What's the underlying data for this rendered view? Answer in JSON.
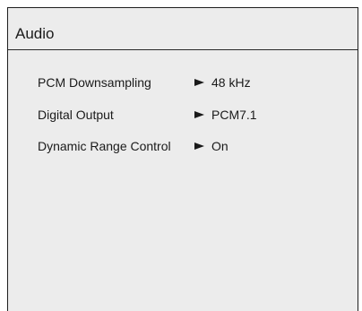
{
  "menu": {
    "title": "Audio",
    "items": [
      {
        "label": "PCM Downsampling",
        "value": "48 kHz",
        "indicator_icon": "right-pointer-icon"
      },
      {
        "label": "Digital Output",
        "value": "PCM7.1",
        "indicator_icon": "right-pointer-icon"
      },
      {
        "label": "Dynamic Range Control",
        "value": "On",
        "indicator_icon": "right-pointer-icon"
      }
    ]
  },
  "colors": {
    "panel_background": "#ececec",
    "border": "#1e1e1e",
    "text": "#1a1a1a"
  }
}
